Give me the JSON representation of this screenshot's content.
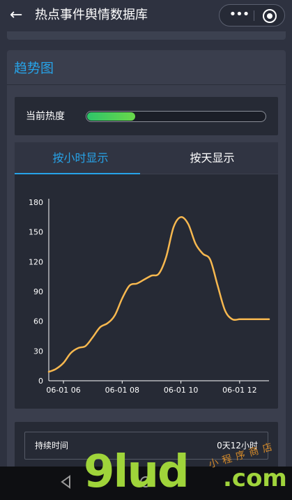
{
  "header": {
    "back_icon": "arrow-left-icon",
    "title": "热点事件舆情数据库",
    "more_icon": "more-dots-icon",
    "close_icon": "target-circle-icon"
  },
  "panel": {
    "title": "趋势图",
    "heat": {
      "label": "当前热度",
      "progress_fraction": 0.27,
      "bar_color_start": "#2fc46a",
      "bar_color_end": "#69d84a"
    },
    "tabs": [
      {
        "label": "按小时显示",
        "active": true
      },
      {
        "label": "按天显示",
        "active": false
      }
    ],
    "duration": {
      "label": "持续时间",
      "value": "0天12小时"
    }
  },
  "chart_data": {
    "type": "line",
    "x": [
      "05:30",
      "05:45",
      "06:00",
      "06:15",
      "06:30",
      "06:45",
      "07:00",
      "07:15",
      "07:30",
      "07:45",
      "08:00",
      "08:15",
      "08:30",
      "08:45",
      "09:00",
      "09:15",
      "09:30",
      "09:45",
      "10:00",
      "10:15",
      "10:30",
      "10:45",
      "11:00",
      "11:15",
      "11:30",
      "11:45",
      "12:00",
      "12:15",
      "12:30",
      "12:45",
      "13:00"
    ],
    "y": [
      9,
      12,
      18,
      28,
      33,
      35,
      44,
      54,
      58,
      66,
      83,
      96,
      98,
      102,
      106,
      108,
      125,
      155,
      165,
      158,
      138,
      128,
      122,
      96,
      71,
      62,
      62,
      62,
      62,
      62,
      62
    ],
    "xticks": [
      "06-01 06",
      "06-01 08",
      "06-01 10",
      "06-01 12"
    ],
    "yticks": [
      "0",
      "30",
      "60",
      "90",
      "120",
      "150",
      "180"
    ],
    "ylim": [
      0,
      180
    ],
    "grid": false,
    "line_color": "#f7b84f"
  },
  "navbar": {
    "back_icon": "triangle-back-icon",
    "home_icon": "circle-home-icon"
  },
  "watermark": {
    "main": "9lud",
    "suffix": ".com",
    "chinese": "小程序商店"
  }
}
